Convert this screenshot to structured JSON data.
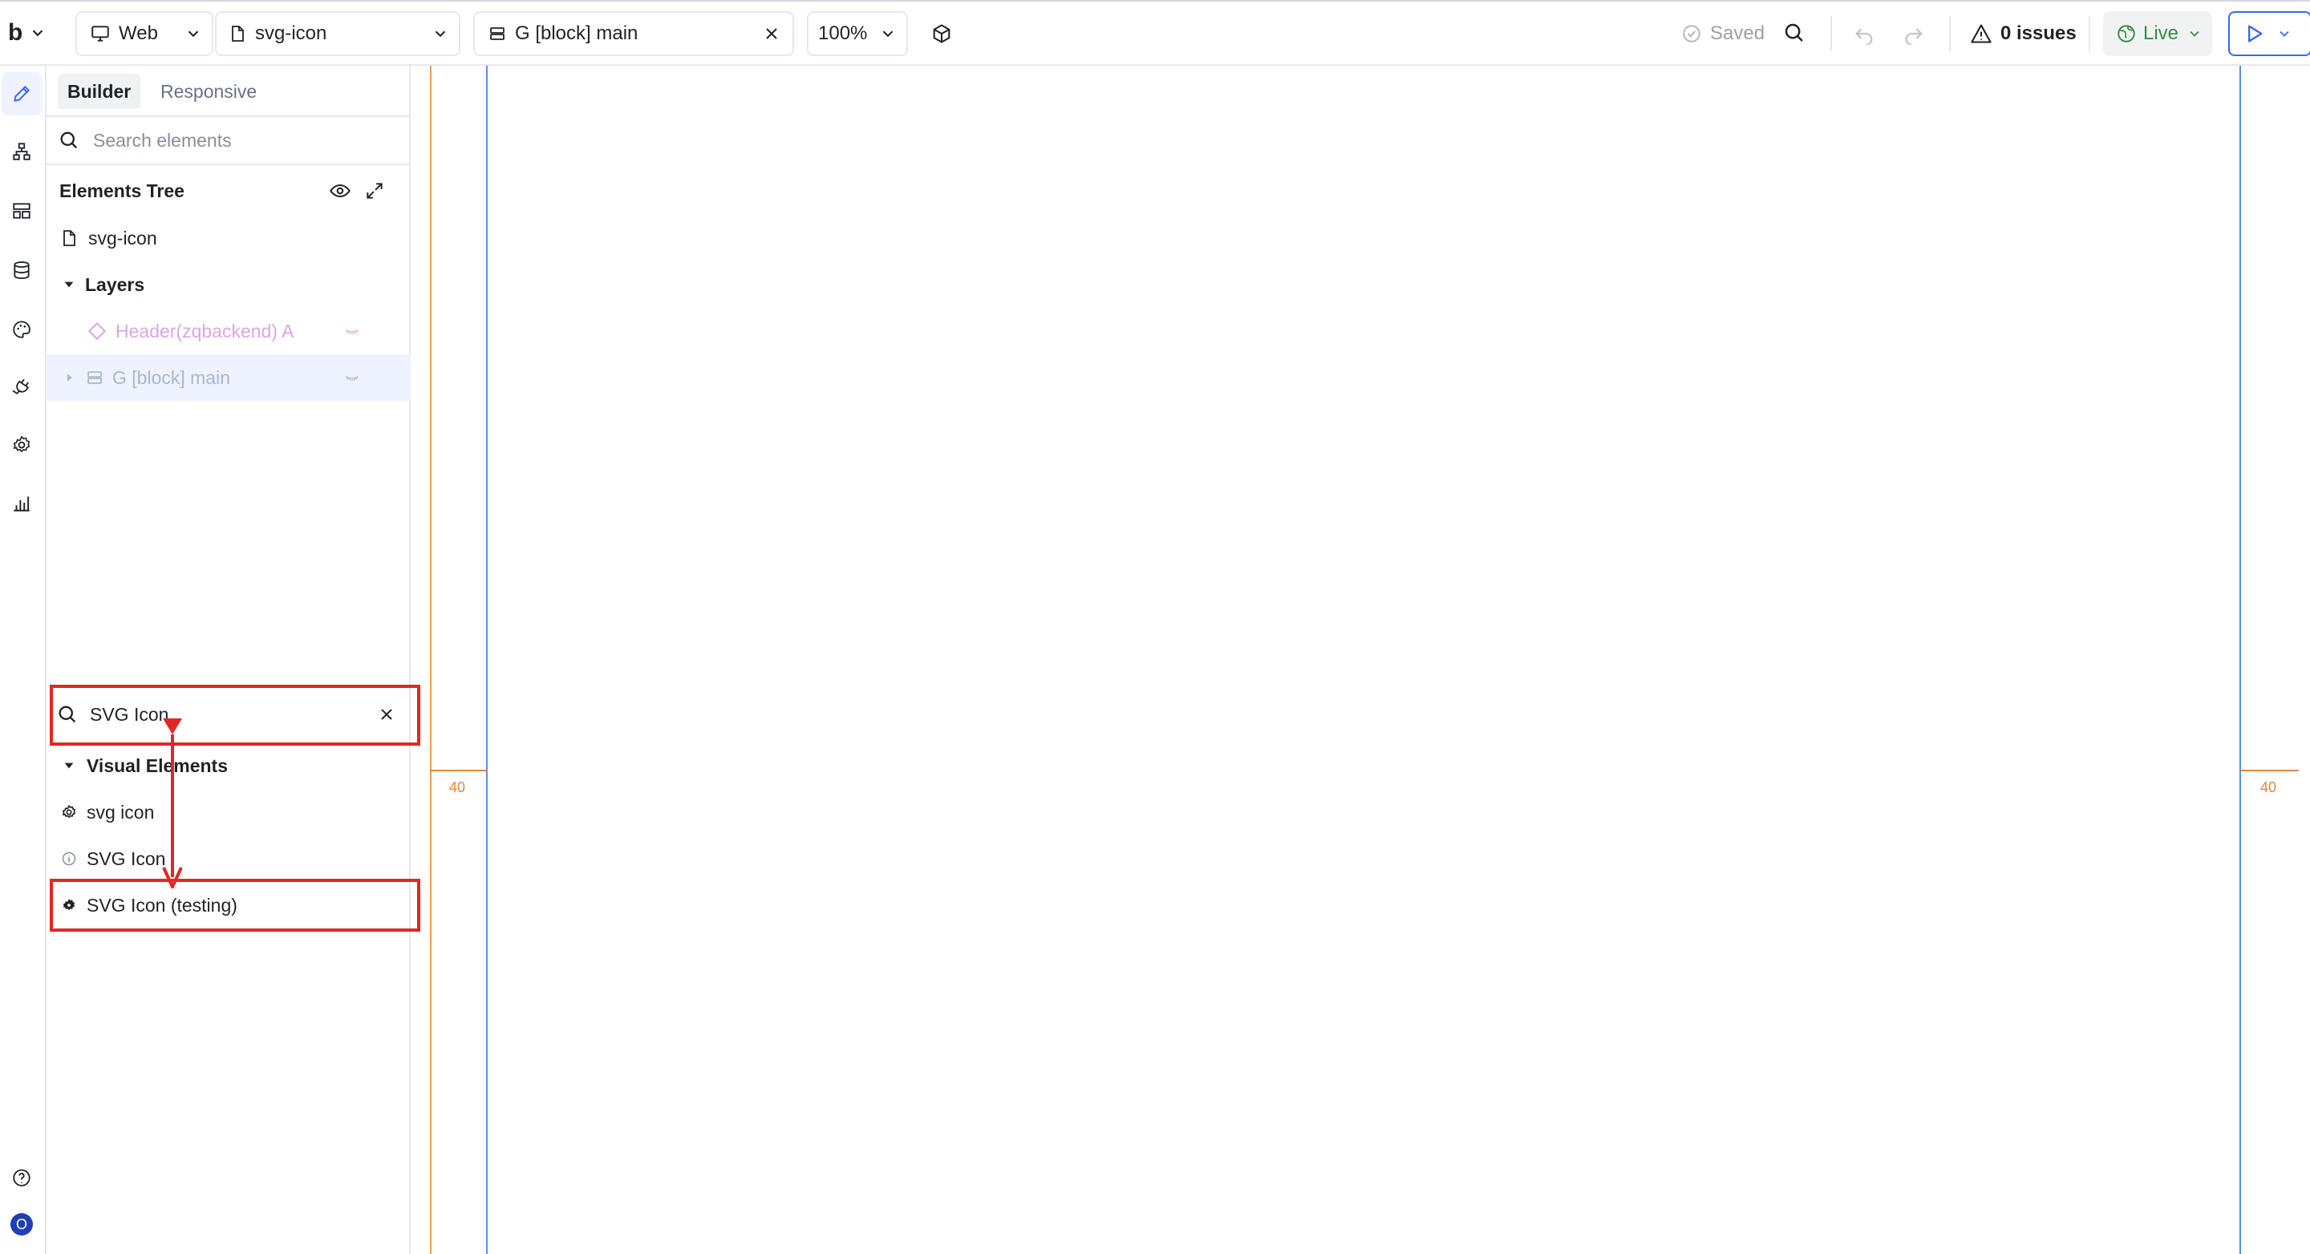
{
  "topbar": {
    "logo": "b",
    "platform": "Web",
    "page": "svg-icon",
    "selected_block": "G [block] main",
    "zoom": "100%",
    "saved_label": "Saved",
    "issues_label": "0 issues",
    "live_label": "Live"
  },
  "panel": {
    "tabs": [
      "Builder",
      "Responsive"
    ],
    "search_placeholder": "Search elements",
    "tree_title": "Elements Tree",
    "page_item": "svg-icon",
    "layers_label": "Layers",
    "layers": [
      {
        "label": "Header(zqbackend) A"
      },
      {
        "label": "G [block] main"
      }
    ],
    "component_search_value": "SVG Icon",
    "group_label": "Visual Elements",
    "results": [
      {
        "label": "svg icon"
      },
      {
        "label": "SVG Icon"
      },
      {
        "label": "SVG Icon (testing)"
      }
    ]
  },
  "canvas": {
    "left_marker": "40",
    "right_marker": "40"
  },
  "rail": {
    "avatar_initial": "O"
  },
  "colors": {
    "accent": "#3b66f5",
    "highlight": "#e32626",
    "guide_orange": "#e0873a",
    "guide_blue": "#5b8def",
    "live_green": "#3a8a4a"
  }
}
